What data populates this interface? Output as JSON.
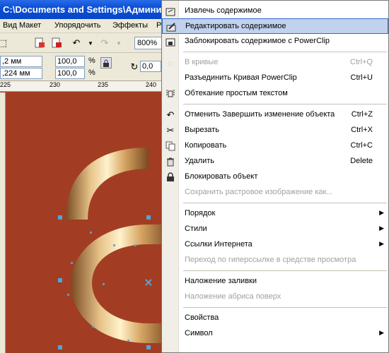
{
  "window": {
    "title": "C:\\Documents and Settings\\Админи"
  },
  "menubar": {
    "items": [
      "Вид",
      "Макет",
      "Упорядочить",
      "Эффекты",
      "Р"
    ]
  },
  "toolbar": {
    "zoom": "800%"
  },
  "props": {
    "x": ",2 мм",
    "y": ",224 мм",
    "scale_x": "100,0",
    "scale_y": "100,0",
    "pct": "%",
    "rotation": "0,0"
  },
  "ruler": {
    "ticks": [
      "225",
      "230",
      "235",
      "240"
    ]
  },
  "context_menu": {
    "items": [
      {
        "label": "Извлечь содержимое",
        "icon": "extract-icon",
        "shortcut": "",
        "disabled": false,
        "submenu": false,
        "highlight": false
      },
      {
        "label": "Редактировать содержимое",
        "icon": "edit-contents-icon",
        "shortcut": "",
        "disabled": false,
        "submenu": false,
        "highlight": true
      },
      {
        "label": "Заблокировать содержимое с PowerClip",
        "icon": "lock-powerclip-icon",
        "shortcut": "",
        "disabled": false,
        "submenu": false,
        "highlight": false
      },
      {
        "label": "В кривые",
        "icon": "curves-icon",
        "shortcut": "Ctrl+Q",
        "disabled": true,
        "submenu": false,
        "highlight": false
      },
      {
        "label": "Разъединить Кривая PowerClip",
        "icon": "",
        "shortcut": "Ctrl+U",
        "disabled": false,
        "submenu": false,
        "highlight": false
      },
      {
        "label": "Обтекание простым текстом",
        "icon": "text-wrap-icon",
        "shortcut": "",
        "disabled": false,
        "submenu": false,
        "highlight": false
      },
      {
        "label": "Отменить Завершить изменение объекта",
        "icon": "undo-icon",
        "shortcut": "Ctrl+Z",
        "disabled": false,
        "submenu": false,
        "highlight": false
      },
      {
        "label": "Вырезать",
        "icon": "scissors-icon",
        "shortcut": "Ctrl+X",
        "disabled": false,
        "submenu": false,
        "highlight": false
      },
      {
        "label": "Копировать",
        "icon": "copy-icon",
        "shortcut": "Ctrl+C",
        "disabled": false,
        "submenu": false,
        "highlight": false
      },
      {
        "label": "Удалить",
        "icon": "trash-icon",
        "shortcut": "Delete",
        "disabled": false,
        "submenu": false,
        "highlight": false
      },
      {
        "label": "Блокировать объект",
        "icon": "padlock-icon",
        "shortcut": "",
        "disabled": false,
        "submenu": false,
        "highlight": false
      },
      {
        "label": "Сохранить растровое изображение как...",
        "icon": "",
        "shortcut": "",
        "disabled": true,
        "submenu": false,
        "highlight": false
      },
      {
        "label": "Порядок",
        "icon": "",
        "shortcut": "",
        "disabled": false,
        "submenu": true,
        "highlight": false
      },
      {
        "label": "Стили",
        "icon": "",
        "shortcut": "",
        "disabled": false,
        "submenu": true,
        "highlight": false
      },
      {
        "label": "Ссылки Интернета",
        "icon": "",
        "shortcut": "",
        "disabled": false,
        "submenu": true,
        "highlight": false
      },
      {
        "label": "Переход по гиперссылке в средстве просмотра",
        "icon": "",
        "shortcut": "",
        "disabled": true,
        "submenu": false,
        "highlight": false
      },
      {
        "label": "Наложение заливки",
        "icon": "",
        "shortcut": "",
        "disabled": false,
        "submenu": false,
        "highlight": false
      },
      {
        "label": "Наложение абриса поверх",
        "icon": "",
        "shortcut": "",
        "disabled": true,
        "submenu": false,
        "highlight": false
      },
      {
        "label": "Свойства",
        "icon": "",
        "shortcut": "",
        "disabled": false,
        "submenu": false,
        "highlight": false
      },
      {
        "label": "Символ",
        "icon": "",
        "shortcut": "",
        "disabled": false,
        "submenu": true,
        "highlight": false
      }
    ]
  },
  "colors": {
    "canvas": "#a23d23",
    "highlight": "#c1d2ee",
    "handle": "#4fa6d6"
  }
}
